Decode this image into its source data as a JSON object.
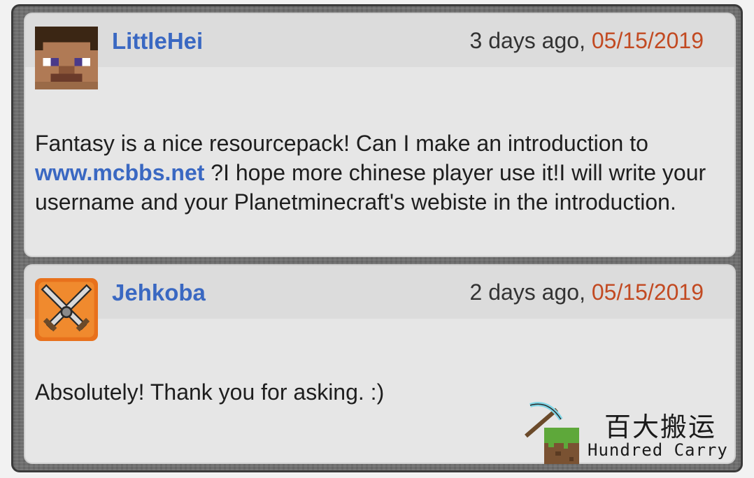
{
  "comments": [
    {
      "username": "LittleHei",
      "relative_time": "3 days ago",
      "separator": ",",
      "date": " 05/15/2019",
      "avatar_icon": "steve-head-icon",
      "body_before_link": "Fantasy is a nice resourcepack! Can I make an introduction to ",
      "link_text": "www.mcbbs.net",
      "body_after_link": " ?I hope more chinese player use it!I will write your username and your Planetminecraft's webiste in the introduction."
    },
    {
      "username": "Jehkoba",
      "relative_time": "2 days ago",
      "separator": ",",
      "date": " 05/15/2019",
      "avatar_icon": "crossed-swords-icon",
      "body": "Absolutely! Thank you for asking. :)"
    }
  ],
  "watermark": {
    "chinese": "百大搬运",
    "english": "Hundred Carry",
    "icon": "pickaxe-grass-block-icon"
  },
  "colors": {
    "username": "#3a68c2",
    "date": "#c24a22",
    "card": "#e6e6e6",
    "frame": "#6f6f6f"
  }
}
